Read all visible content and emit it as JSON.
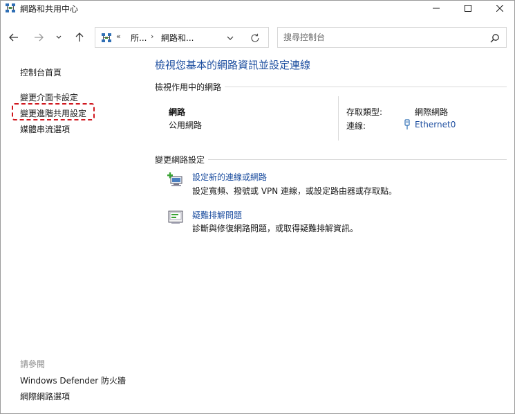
{
  "window": {
    "title": "網路和共用中心"
  },
  "navigation": {
    "address_overflow": "«",
    "crumb_separator": "›",
    "breadcrumbs": [
      "所...",
      "網路和..."
    ],
    "search_placeholder": "搜尋控制台"
  },
  "sidebar": {
    "home": "控制台首頁",
    "items": [
      {
        "label": "變更介面卡設定"
      },
      {
        "label": "變更進階共用設定",
        "highlighted": true
      },
      {
        "label": "媒體串流選項"
      }
    ],
    "see_also_label": "請參閱",
    "see_also": [
      {
        "label": "Windows Defender 防火牆"
      },
      {
        "label": "網際網路選項"
      }
    ]
  },
  "main": {
    "title": "檢視您基本的網路資訊並設定連線",
    "active_networks": {
      "heading": "檢視作用中的網路",
      "network_name": "網路",
      "network_type": "公用網路",
      "access_type_label": "存取類型:",
      "access_type_value": "網際網路",
      "connections_label": "連線:",
      "connection_value": "Ethernet0"
    },
    "change_settings": {
      "heading": "變更網路設定",
      "tasks": [
        {
          "title": "設定新的連線或網路",
          "description": "設定寬頻、撥號或 VPN 連線，或設定路由器或存取點。",
          "icon": "network-setup-icon"
        },
        {
          "title": "疑難排解問題",
          "description": "診斷與修復網路問題，或取得疑難排解資訊。",
          "icon": "troubleshoot-icon"
        }
      ]
    }
  },
  "colors": {
    "link": "#1e4fa0",
    "highlight_border": "#d0171e",
    "muted_text": "#8a8a8a"
  }
}
